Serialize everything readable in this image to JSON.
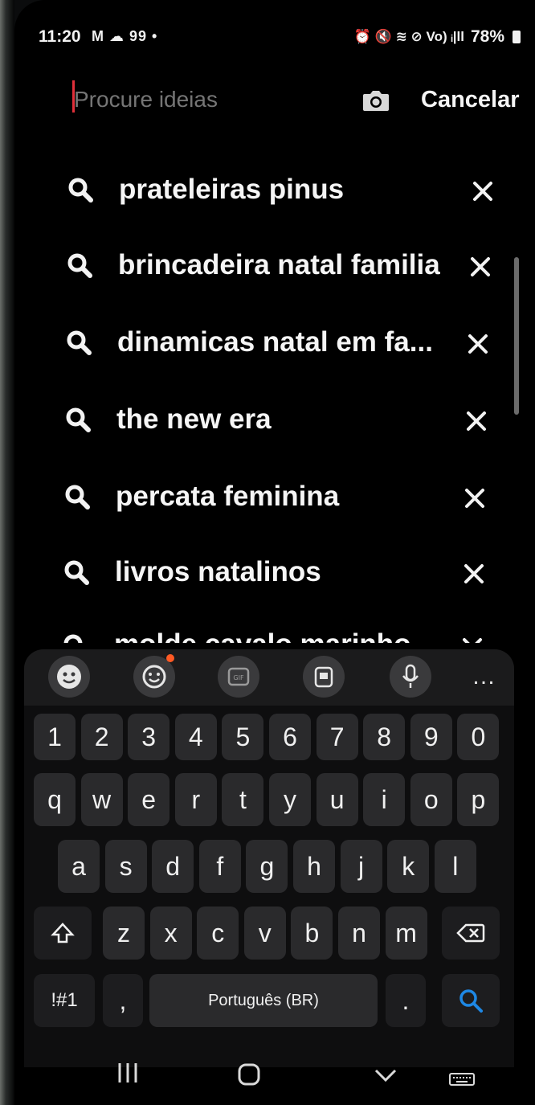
{
  "status": {
    "time": "11:20",
    "notif_icons": "M ☁ 99 •",
    "right_icons": "⏰ 🔇 ≋ ⊘ Vo) ᵢ|ll",
    "battery": "78%"
  },
  "search": {
    "placeholder": "Procure ideias",
    "cancel_label": "Cancelar"
  },
  "suggestions": [
    "prateleiras pinus",
    "brincadeira natal familia",
    "dinamicas natal em fa...",
    "the new era",
    "percata feminina",
    "livros natalinos",
    "molde cavalo marinho"
  ],
  "keyboard": {
    "toolbar": {
      "icons": [
        "emoji-face-icon",
        "sticker-icon",
        "gif-icon",
        "clipboard-icon",
        "microphone-icon",
        "more-icon"
      ],
      "more_label": "…"
    },
    "row_numbers": [
      "1",
      "2",
      "3",
      "4",
      "5",
      "6",
      "7",
      "8",
      "9",
      "0"
    ],
    "row_1": [
      "q",
      "w",
      "e",
      "r",
      "t",
      "y",
      "u",
      "i",
      "o",
      "p"
    ],
    "row_2": [
      "a",
      "s",
      "d",
      "f",
      "g",
      "h",
      "j",
      "k",
      "l"
    ],
    "row_3": [
      "z",
      "x",
      "c",
      "v",
      "b",
      "n",
      "m"
    ],
    "symbols_label": "!#1",
    "comma_label": ",",
    "space_label": "Português (BR)",
    "period_label": ".",
    "accent_color": "#1e88e5"
  },
  "navigation": {
    "icons": [
      "recent-apps-icon",
      "home-icon",
      "back-icon",
      "keyboard-hide-icon"
    ]
  }
}
